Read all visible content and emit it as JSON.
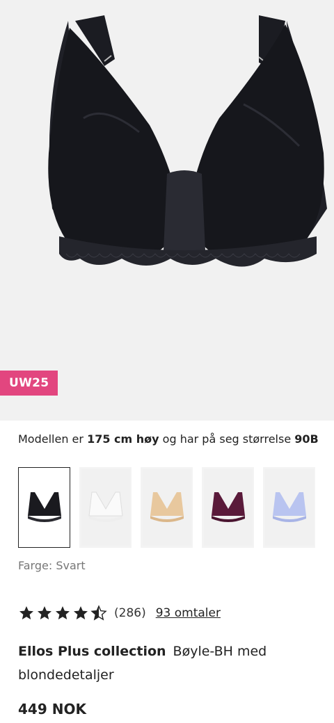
{
  "product_image": {
    "alt_icon": "bra-product-image"
  },
  "badge": {
    "label": "UW25",
    "color": "#e2467f"
  },
  "model_info": {
    "prefix": "Modellen er ",
    "height": "175 cm høy",
    "middle": " og har på seg størrelse ",
    "size": "90B"
  },
  "swatches": [
    {
      "name": "Svart",
      "color": "#1a1a1f",
      "selected": true
    },
    {
      "name": "Hvit",
      "color": "#f7f7f7",
      "selected": false
    },
    {
      "name": "Beige",
      "color": "#e8c89e",
      "selected": false
    },
    {
      "name": "Plomme",
      "color": "#5a1a3a",
      "selected": false
    },
    {
      "name": "Lyseblå",
      "color": "#b9c4f0",
      "selected": false
    }
  ],
  "color_label": "Farge: Svart",
  "rating": {
    "stars": 4.5,
    "count_text": "(286)",
    "reviews_link": "93 omtaler"
  },
  "product": {
    "brand": "Ellos Plus collection",
    "name": "Bøyle-BH med blondedetaljer",
    "price": "449 NOK"
  }
}
